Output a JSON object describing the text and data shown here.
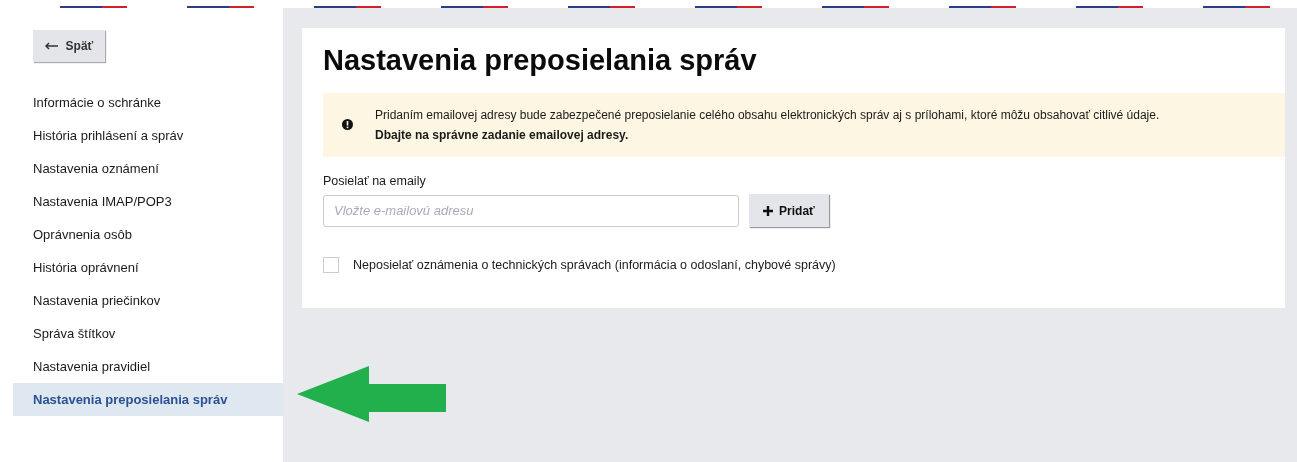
{
  "back_button": {
    "label": "Späť"
  },
  "sidebar": {
    "items": [
      {
        "label": "Informácie o schránke",
        "selected": false
      },
      {
        "label": "História prihlásení a správ",
        "selected": false
      },
      {
        "label": "Nastavenia oznámení",
        "selected": false
      },
      {
        "label": "Nastavenia IMAP/POP3",
        "selected": false
      },
      {
        "label": "Oprávnenia osôb",
        "selected": false
      },
      {
        "label": "História oprávnení",
        "selected": false
      },
      {
        "label": "Nastavenia priečinkov",
        "selected": false
      },
      {
        "label": "Správa štítkov",
        "selected": false
      },
      {
        "label": "Nastavenia pravidiel",
        "selected": false
      },
      {
        "label": "Nastavenia preposielania správ",
        "selected": true
      }
    ]
  },
  "page": {
    "title": "Nastavenia preposielania správ",
    "notice": {
      "text": "Pridaním emailovej adresy bude zabezpečené preposielanie celého obsahu elektronických správ aj s prílohami, ktoré môžu obsahovať citlivé údaje.",
      "emphasis": "Dbajte na správne zadanie emailovej adresy."
    },
    "email_field": {
      "label": "Posielať na emaily",
      "placeholder": "Vložte e-mailovú adresu"
    },
    "add_button": {
      "label": "Pridať"
    },
    "option": {
      "label": "Neposielať oznámenia o technických správach (informácia o odoslaní, chybové správy)",
      "checked": false
    }
  }
}
